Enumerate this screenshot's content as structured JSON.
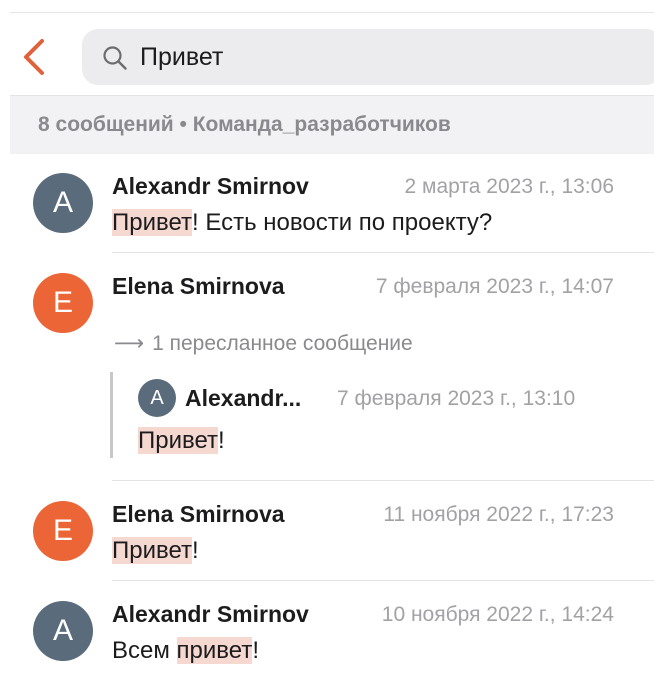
{
  "header": {
    "back_icon": "chevron-left-icon",
    "search_icon": "search-icon",
    "search_value": "Привет",
    "accent_color": "#e0613a"
  },
  "subheader": {
    "text": "8 сообщений • Команда_разработчиков"
  },
  "results": [
    {
      "avatar_letter": "A",
      "avatar_color": "#5a6c7c",
      "author": "Alexandr Smirnov",
      "date": "2 марта 2023 г., 13:06",
      "text_before": "",
      "highlight": "Привет",
      "text_after": "! Есть новости по проекту?"
    },
    {
      "avatar_letter": "E",
      "avatar_color": "#ec6537",
      "author": "Elena Smirnova",
      "date": "7 февраля 2023 г., 14:07",
      "forwarded_label": "1 пересланное сообщение",
      "forwarded": {
        "avatar_letter": "A",
        "author": "Alexandr...",
        "date": "7 февраля 2023 г., 13:10",
        "highlight": "Привет",
        "text_after": "!"
      }
    },
    {
      "avatar_letter": "E",
      "avatar_color": "#ec6537",
      "author": "Elena Smirnova",
      "date": "11 ноября 2022 г., 17:23",
      "text_before": "",
      "highlight": "Привет",
      "text_after": "!"
    },
    {
      "avatar_letter": "A",
      "avatar_color": "#5a6c7c",
      "author": "Alexandr Smirnov",
      "date": "10 ноября 2022 г., 14:24",
      "text_before": "Всем ",
      "highlight": "привет",
      "text_after": "!"
    }
  ]
}
